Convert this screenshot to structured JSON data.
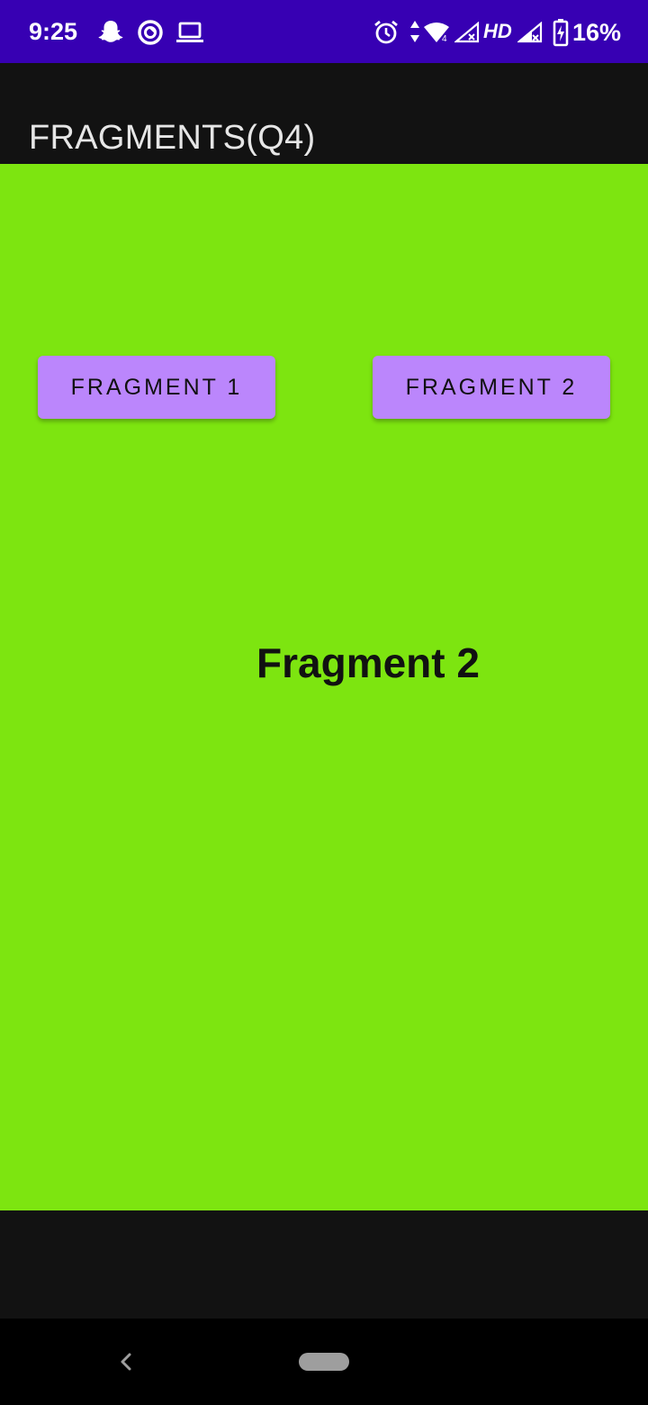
{
  "status_bar": {
    "time": "9:25",
    "network_label": "HD",
    "battery_percent": "16%",
    "background_color": "#3700b3",
    "icons_left": [
      "snapchat-icon",
      "sync-icon",
      "laptop-icon"
    ],
    "icons_right": [
      "alarm-icon",
      "data-arrows-icon",
      "wifi-icon",
      "signal-icon",
      "signal-no-service-icon",
      "battery-charging-icon"
    ]
  },
  "app_bar": {
    "title": "FRAGMENTS(Q4)",
    "background_color": "#121212"
  },
  "main": {
    "background_color": "#7de510",
    "buttons": [
      {
        "label": "FRAGMENT 1"
      },
      {
        "label": "FRAGMENT 2"
      }
    ],
    "button_color": "#bb86fc",
    "fragment_text": "Fragment 2"
  },
  "nav_bar": {
    "icons": [
      "back-icon",
      "home-pill-icon"
    ]
  }
}
